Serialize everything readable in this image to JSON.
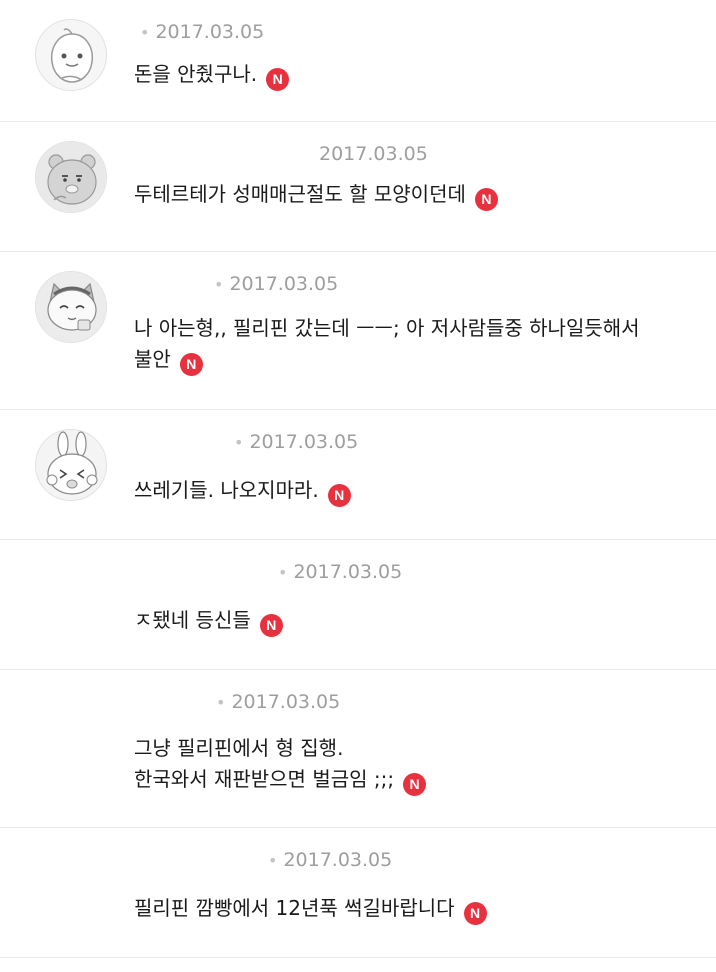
{
  "badge": {
    "new": "N"
  },
  "comments": [
    {
      "nick": "",
      "date": "2017.03.05",
      "lines": [
        "돈을 안줬구나."
      ],
      "avatar": "apeach-icon"
    },
    {
      "nick": "",
      "date": "2017.03.05",
      "lines": [
        "두테르테가 성매매근절도 할 모양이던데"
      ],
      "avatar": "ryan-icon"
    },
    {
      "nick": "",
      "date": "2017.03.05",
      "lines": [
        "나 아는형,, 필리핀 갔는데 ㅡㅡ; 아 저사람들중 하나일듯해서",
        "불안"
      ],
      "avatar": "cat-icon"
    },
    {
      "nick": "",
      "date": "2017.03.05",
      "lines": [
        "쓰레기들. 나오지마라."
      ],
      "avatar": "rabbit-icon"
    },
    {
      "nick": "",
      "date": "2017.03.05",
      "lines": [
        "ㅈ됐네 등신들"
      ],
      "avatar": ""
    },
    {
      "nick": "",
      "date": "2017.03.05",
      "lines": [
        "그냥 필리핀에서 형 집행.",
        "한국와서 재판받으면 벌금임 ;;;"
      ],
      "avatar": ""
    },
    {
      "nick": "",
      "date": "2017.03.05",
      "lines": [
        "필리핀 깜빵에서 12년푹 썩길바랍니다"
      ],
      "avatar": ""
    }
  ]
}
